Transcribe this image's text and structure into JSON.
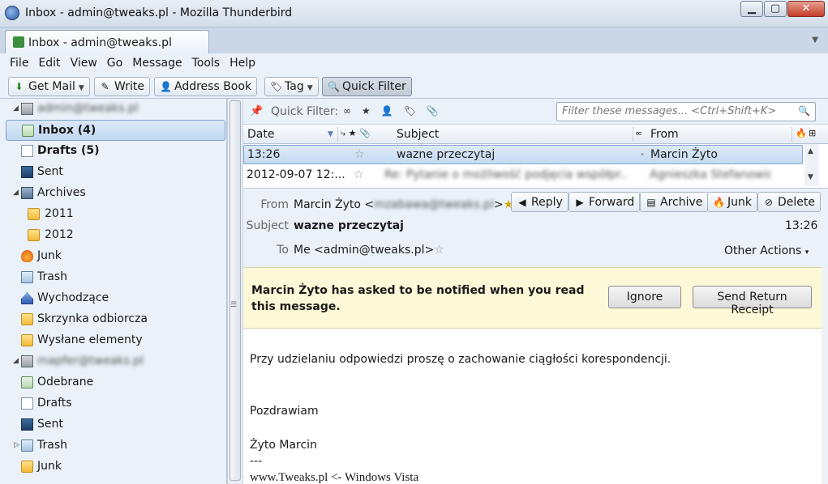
{
  "window": {
    "title": "Inbox - admin@tweaks.pl - Mozilla Thunderbird",
    "minimize": "▁",
    "maximize": "▢",
    "close": "✕"
  },
  "tab": {
    "label": "Inbox - admin@tweaks.pl"
  },
  "menu": [
    "File",
    "Edit",
    "View",
    "Go",
    "Message",
    "Tools",
    "Help"
  ],
  "toolbar": {
    "get_mail": "Get Mail",
    "write": "Write",
    "address_book": "Address Book",
    "tag": "Tag",
    "quick_filter": "Quick Filter"
  },
  "folders": [
    {
      "label": "admin@tweaks.pl",
      "icon": "account-icon",
      "blurred": true
    },
    {
      "label": "Inbox (4)",
      "icon": "inbox-icon",
      "selected": true,
      "bold": true
    },
    {
      "label": "Drafts (5)",
      "icon": "draft-icon",
      "bold": true
    },
    {
      "label": "Sent",
      "icon": "sent-icon"
    },
    {
      "label": "Archives",
      "icon": "archive-icon"
    },
    {
      "label": "2011",
      "icon": "folder-icon"
    },
    {
      "label": "2012",
      "icon": "folder-icon"
    },
    {
      "label": "Junk",
      "icon": "junk-icon"
    },
    {
      "label": "Trash",
      "icon": "trash-icon"
    },
    {
      "label": "Wychodzące",
      "icon": "outbox-icon"
    },
    {
      "label": "Skrzynka odbiorcza",
      "icon": "folder-icon"
    },
    {
      "label": "Wysłane elementy",
      "icon": "folder-icon"
    },
    {
      "label": "mapfer@tweaks.pl",
      "icon": "account-icon",
      "blurred": true
    },
    {
      "label": "Odebrane",
      "icon": "inbox-icon"
    },
    {
      "label": "Drafts",
      "icon": "draft-icon"
    },
    {
      "label": "Sent",
      "icon": "sent-icon"
    },
    {
      "label": "Trash",
      "icon": "trash-icon"
    },
    {
      "label": "Junk",
      "icon": "folder-icon"
    }
  ],
  "quick_filter": {
    "label": "Quick Filter:",
    "placeholder": "Filter these messages... <Ctrl+Shift+K>"
  },
  "thread_columns": {
    "date": "Date",
    "subject": "Subject",
    "from": "From"
  },
  "threads": [
    {
      "date": "13:26",
      "subject": "wazne przeczytaj",
      "from": "Marcin Żyto",
      "selected": true
    },
    {
      "date": "2012-09-07 12:...",
      "subject": "Re: Pytanie o możliwość podjęcia współpr...",
      "from": "Agnieszka Stefanowicz",
      "blurred": true
    }
  ],
  "message": {
    "from_label": "From",
    "from_name": "Marcin Żyto <",
    "from_email": "mzabawa@tweaks.pl",
    "from_close": ">",
    "subject_label": "Subject",
    "subject": "wazne przeczytaj",
    "time": "13:26",
    "to_label": "To",
    "to": "Me <admin@tweaks.pl>",
    "other_actions": "Other Actions",
    "actions": {
      "reply": "Reply",
      "forward": "Forward",
      "archive": "Archive",
      "junk": "Junk",
      "delete": "Delete"
    }
  },
  "mdn": {
    "text": "Marcin Żyto has asked to be notified when you read this message.",
    "ignore": "Ignore",
    "send_receipt": "Send Return Receipt"
  },
  "body": {
    "line1": "Przy udzielaniu odpowiedzi proszę o zachowanie ciągłości korespondencji.",
    "line2": "Pozdrawiam",
    "line3": "Żyto Marcin",
    "line4": "---",
    "line5": "www.Tweaks.pl <- Windows Vista"
  }
}
